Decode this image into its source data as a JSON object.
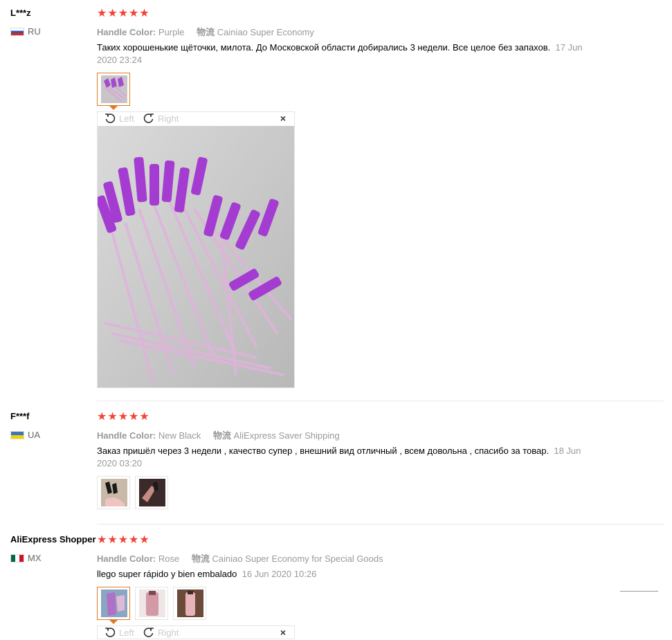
{
  "reviews": [
    {
      "user": "L***z",
      "country": "RU",
      "rating": 5,
      "sku_label": "Handle Color:",
      "sku_value": "Purple",
      "shipping_label": "物流",
      "shipping_value": "Cainiao Super Economy",
      "text": "Таких хорошенькие щёточки, милота. До Московской области добирались 3 недели. Все целое без запахов.",
      "date": "17 Jun 2020 23:24"
    },
    {
      "user": "F***f",
      "country": "UA",
      "rating": 5,
      "sku_label": "Handle Color:",
      "sku_value": "New Black",
      "shipping_label": "物流",
      "shipping_value": "AliExpress Saver Shipping",
      "text": "Заказ пришёл через 3 недели , качество супер , внешний вид отличный , всем довольна , спасибо за товар.",
      "date": "18 Jun 2020 03:20"
    },
    {
      "user": "AliExpress Shopper",
      "country": "MX",
      "rating": 5,
      "sku_label": "Handle Color:",
      "sku_value": "Rose",
      "shipping_label": "物流",
      "shipping_value": "Cainiao Super Economy for Special Goods",
      "text": "llego super rápido y bien embalado",
      "date": "16 Jun 2020 10:26"
    }
  ],
  "viewer": {
    "rotate_left": "Left",
    "rotate_right": "Right",
    "close": "×"
  },
  "icons": {
    "star": "star-icon",
    "rotate_left": "rotate-left-icon",
    "rotate_right": "rotate-right-icon",
    "close": "close-icon"
  },
  "colors": {
    "star": "#f44336",
    "active_thumb_border": "#e07a22",
    "muted_text": "#999999"
  }
}
